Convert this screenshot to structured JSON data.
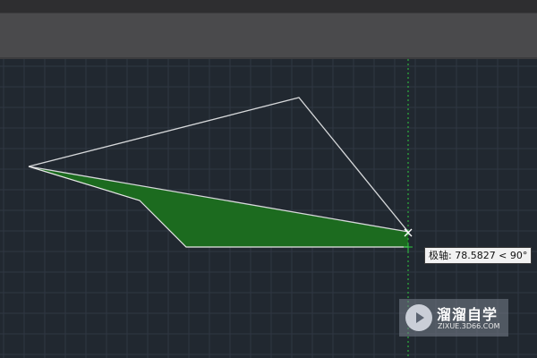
{
  "tooltip": {
    "text": "极轴: 78.5827 < 90°"
  },
  "watermark": {
    "title": "溜溜自学",
    "url": "ZIXUE.3D66.COM",
    "logo_icon": "play-circle-icon"
  },
  "colors": {
    "canvas_background": "#212830",
    "grid_line": "#2f3742",
    "shape_stroke": "#d6d8da",
    "hatch_fill": "#1c6b1f",
    "polar_tracking": "#2ecc40",
    "snap_marker": "#ffffff"
  },
  "drawing": {
    "shapes": [
      "outline-polyline",
      "hatched-region",
      "polar-tracking-line",
      "endpoint-snap-marker"
    ]
  }
}
